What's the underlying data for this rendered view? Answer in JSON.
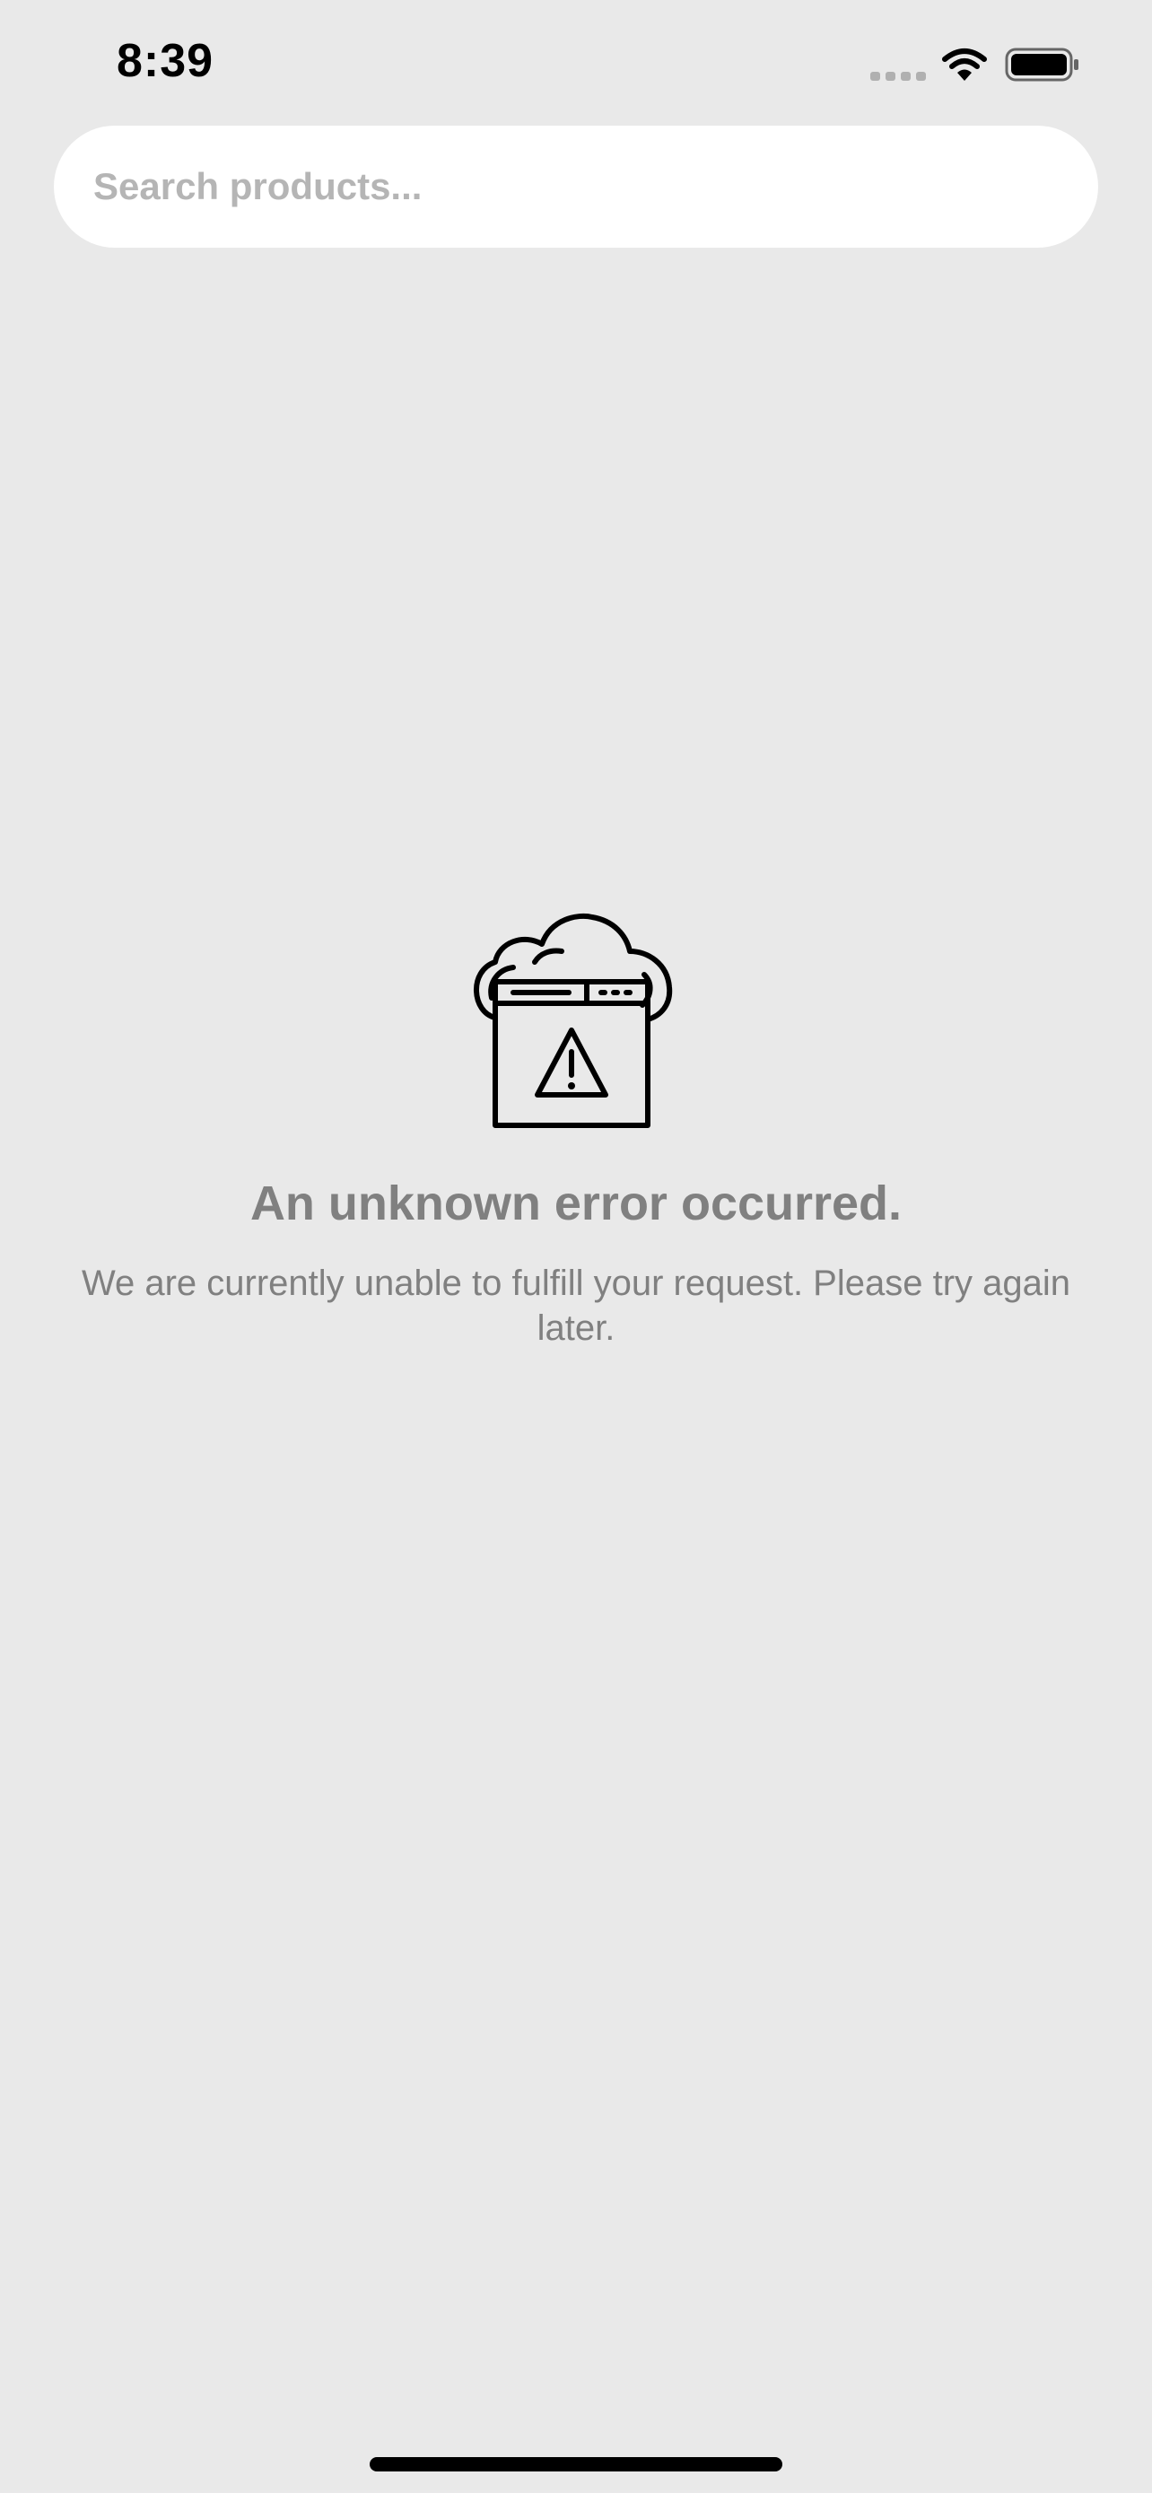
{
  "status_bar": {
    "time": "8:39",
    "signal_icon": "cellular-signal-dots-icon",
    "wifi_icon": "wifi-icon",
    "battery_icon": "battery-full-icon"
  },
  "search": {
    "placeholder": "Search products...",
    "value": ""
  },
  "error": {
    "icon": "cloud-browser-warning-icon",
    "title": "An unknown error occurred.",
    "message": "We are currently unable to fulfill your request. Please try again later."
  },
  "colors": {
    "background": "#e9e9e9",
    "search_bg": "#ffffff",
    "placeholder": "#b5b5b5",
    "error_text": "#808080",
    "icon_stroke": "#000000"
  }
}
